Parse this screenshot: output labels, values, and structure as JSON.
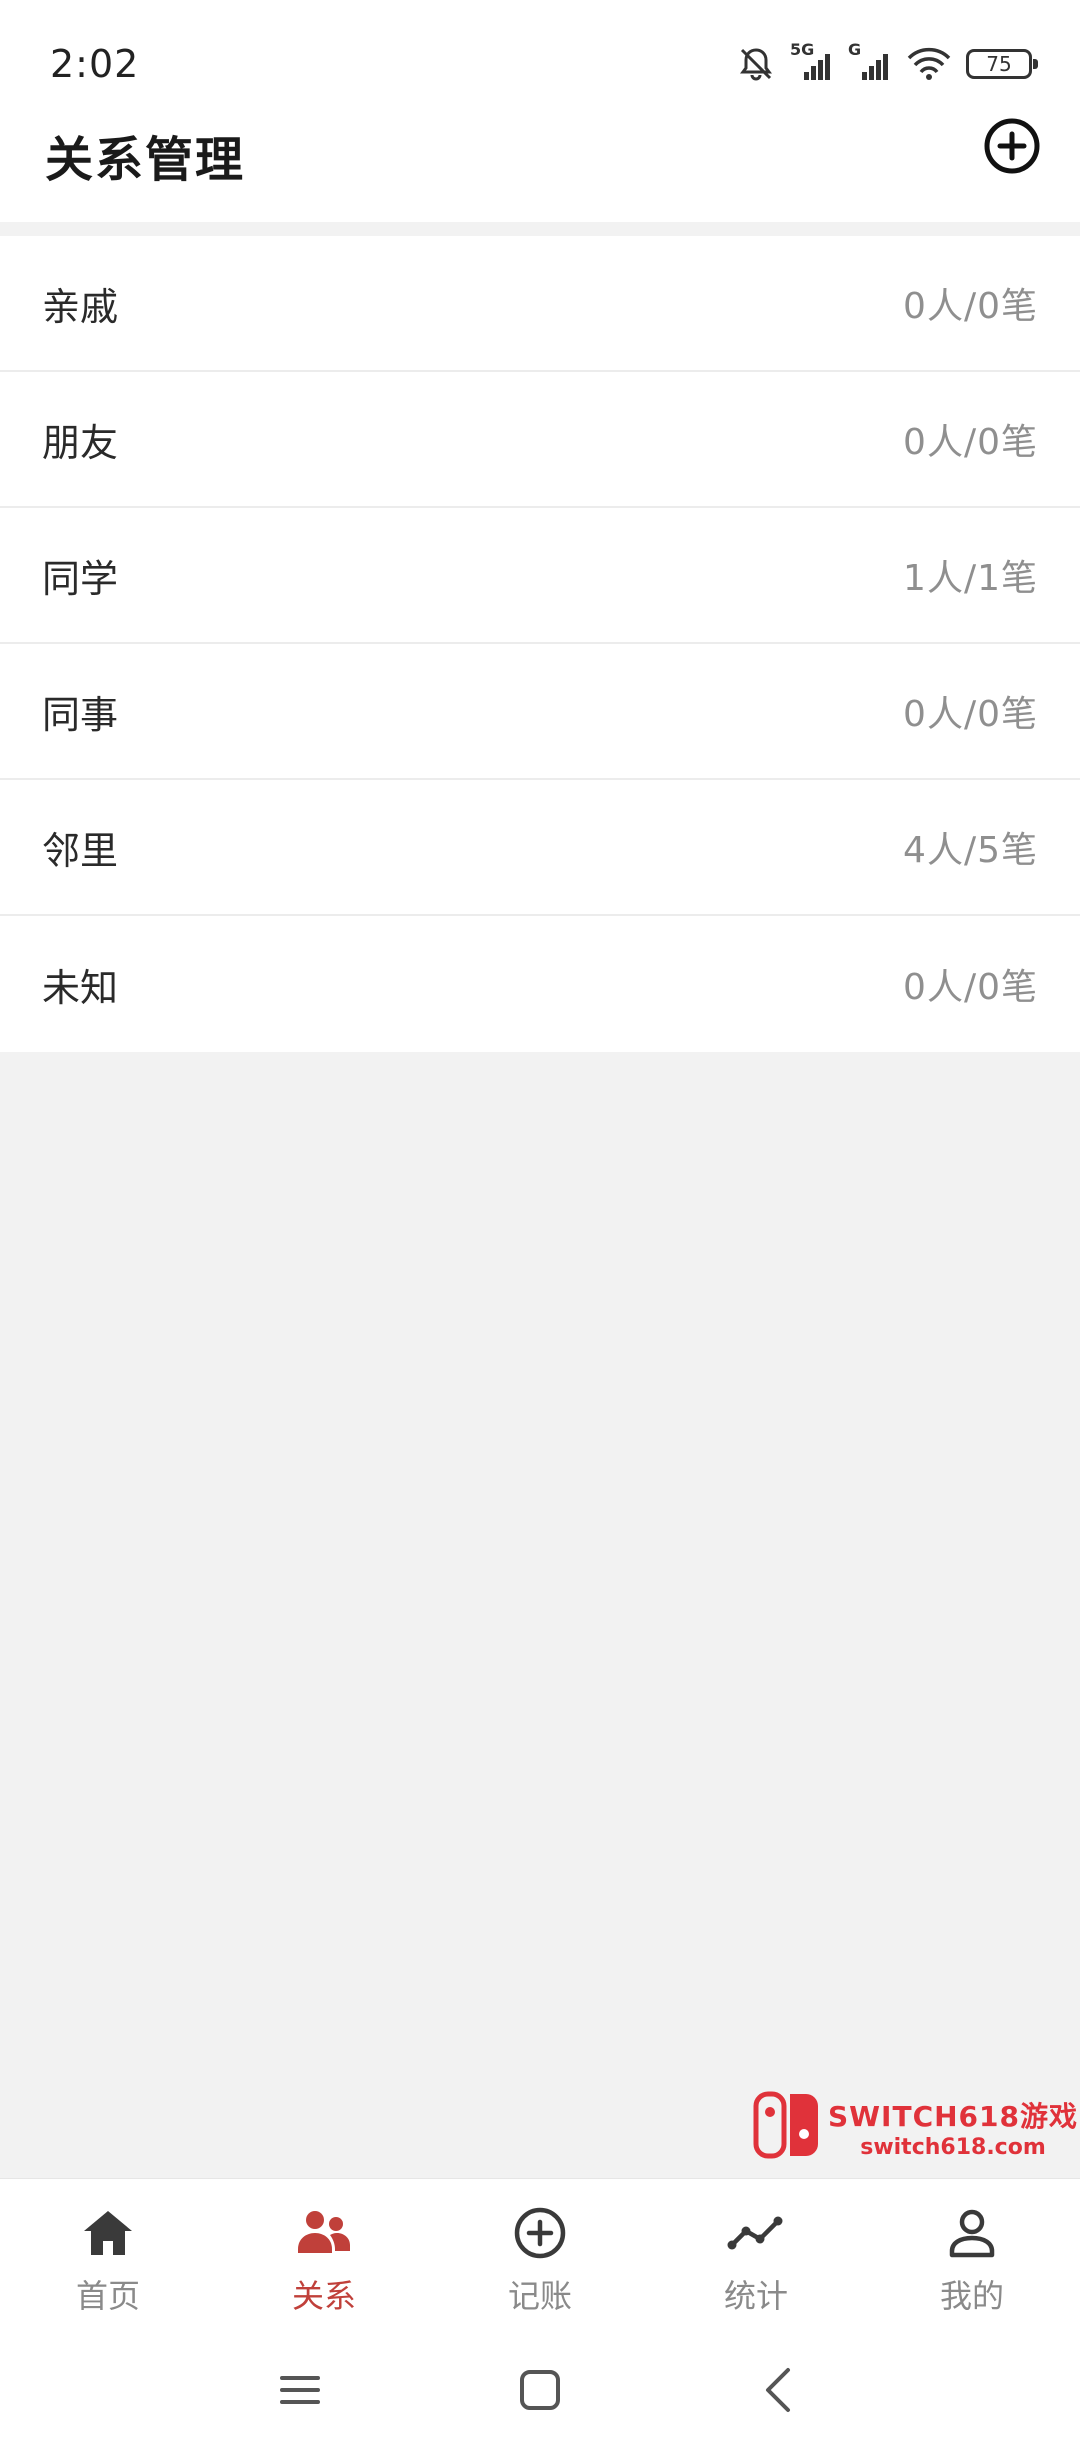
{
  "status_bar": {
    "time": "2:02",
    "network_5g": "5G",
    "network_g": "G",
    "battery": "75"
  },
  "header": {
    "title": "关系管理",
    "add_icon": "plus-circle-icon"
  },
  "groups": [
    {
      "name": "亲戚",
      "count": "0人/0笔"
    },
    {
      "name": "朋友",
      "count": "0人/0笔"
    },
    {
      "name": "同学",
      "count": "1人/1笔"
    },
    {
      "name": "同事",
      "count": "0人/0笔"
    },
    {
      "name": "邻里",
      "count": "4人/5笔"
    },
    {
      "name": "未知",
      "count": "0人/0笔"
    }
  ],
  "watermark": {
    "line1": "SWITCH618游戏",
    "line2": "switch618.com"
  },
  "tabs": [
    {
      "label": "首页",
      "icon": "home-icon",
      "active": false
    },
    {
      "label": "关系",
      "icon": "people-icon",
      "active": true
    },
    {
      "label": "记账",
      "icon": "plus-circle-icon",
      "active": false
    },
    {
      "label": "统计",
      "icon": "trend-line-icon",
      "active": false
    },
    {
      "label": "我的",
      "icon": "user-icon",
      "active": false
    }
  ],
  "colors": {
    "accent": "#c0403a",
    "inactive": "#8a8a8a",
    "background": "#f2f2f2"
  }
}
